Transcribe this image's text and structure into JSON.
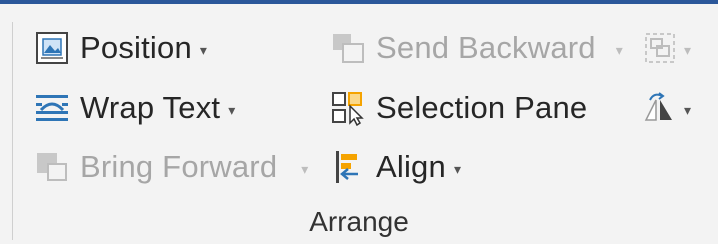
{
  "ribbon": {
    "group_label": "Arrange",
    "buttons": {
      "position": {
        "label": "Position",
        "icon": "position-icon",
        "caret": "▾"
      },
      "wrap_text": {
        "label": "Wrap Text",
        "icon": "wrap-text-icon",
        "caret": "▾"
      },
      "bring_forward": {
        "label": "Bring Forward",
        "icon": "bring-forward-icon",
        "caret": "▾",
        "state": "disabled"
      },
      "send_backward": {
        "label": "Send Backward",
        "icon": "send-backward-icon",
        "caret": "▾",
        "state": "disabled"
      },
      "selection_pane": {
        "label": "Selection Pane",
        "icon": "selection-pane-icon"
      },
      "align": {
        "label": "Align",
        "icon": "align-icon",
        "caret": "▾"
      },
      "group": {
        "icon": "group-objects-icon",
        "caret": "▾",
        "state": "disabled"
      },
      "rotate": {
        "icon": "rotate-icon",
        "caret": "▾"
      }
    }
  },
  "colors": {
    "accent": "#2b579a",
    "icon_blue": "#2e75b6",
    "icon_orange": "#f5a300",
    "disabled": "#a6a6a6"
  }
}
